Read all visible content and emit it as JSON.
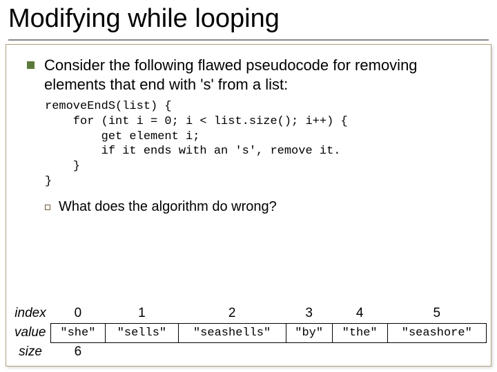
{
  "title": "Modifying while looping",
  "bullet": "Consider the following flawed pseudocode for removing elements that end with 's' from a list:",
  "code": "removeEndS(list) {\n    for (int i = 0; i < list.size(); i++) {\n        get element i;\n        if it ends with an 's', remove it.\n    }\n}",
  "sub_bullet": "What does the algorithm do wrong?",
  "table": {
    "row_labels": {
      "index": "index",
      "value": "value",
      "size": "size"
    },
    "indices": [
      "0",
      "1",
      "2",
      "3",
      "4",
      "5"
    ],
    "values": [
      "\"she\"",
      "\"sells\"",
      "\"seashells\"",
      "\"by\"",
      "\"the\"",
      "\"seashore\""
    ],
    "size": "6"
  }
}
